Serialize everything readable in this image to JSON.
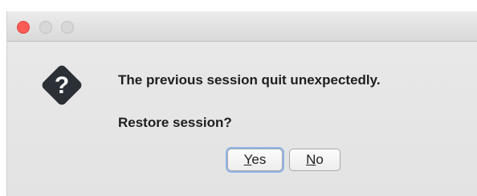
{
  "dialog": {
    "message_line1": "The previous session quit unexpectedly.",
    "message_line2": "Restore session?",
    "icon": "question-diamond-icon",
    "buttons": {
      "yes": {
        "mnemonic": "Y",
        "rest": "es"
      },
      "no": {
        "mnemonic": "N",
        "rest": "o"
      }
    },
    "default_button": "yes"
  },
  "colors": {
    "close": "#fc5b57",
    "inactive_light": "#d7d7d7",
    "icon": "#2b2f36",
    "focus_ring": "#8fb3e6"
  }
}
